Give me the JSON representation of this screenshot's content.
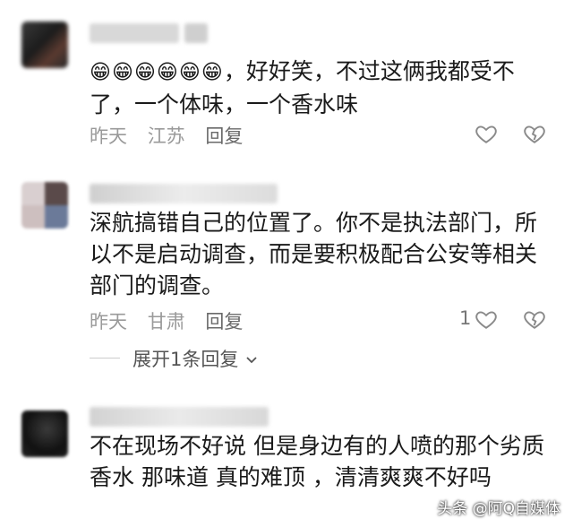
{
  "comments": [
    {
      "emoji": "😁😁😁😁😁😁",
      "text": "，好好笑，不过这俩我都受不了，一个体味，一个香水味",
      "time": "昨天",
      "location": "江苏",
      "reply_label": "回复",
      "likes": ""
    },
    {
      "text": "深航搞错自己的位置了。你不是执法部门，所以不是启动调查，而是要积极配合公安等相关部门的调查。",
      "time": "昨天",
      "location": "甘肃",
      "reply_label": "回复",
      "likes": "1"
    },
    {
      "text": "不在现场不好说  但是身边有的人喷的那个劣质香水  那味道  真的难顶  ，清清爽爽不好吗"
    }
  ],
  "expand_replies": "展开1条回复",
  "watermark": "头条 @阿Q自媒体",
  "colors": {
    "text": "#1a1a1a",
    "meta": "#9a9a9a",
    "icon": "#888888"
  }
}
